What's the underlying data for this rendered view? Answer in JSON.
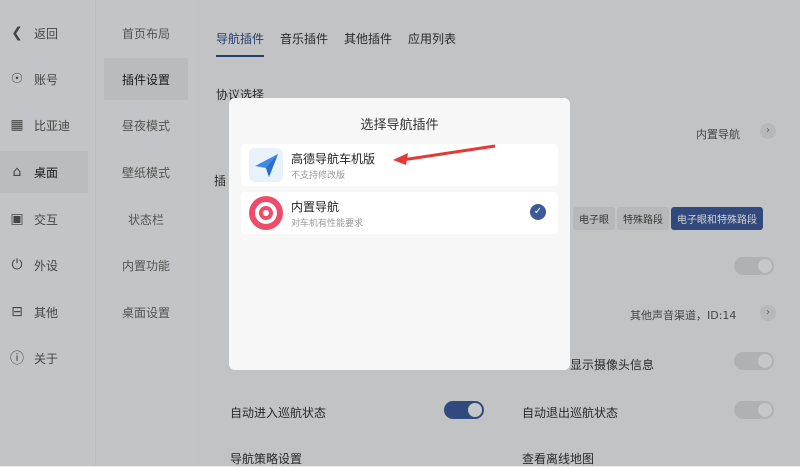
{
  "sidebar": {
    "items": [
      {
        "icon": "back-icon",
        "label": "返回"
      },
      {
        "icon": "account-icon",
        "label": "账号"
      },
      {
        "icon": "byd-icon",
        "label": "比亚迪"
      },
      {
        "icon": "home-icon",
        "label": "桌面"
      },
      {
        "icon": "interaction-icon",
        "label": "交互"
      },
      {
        "icon": "power-icon",
        "label": "外设"
      },
      {
        "icon": "other-icon",
        "label": "其他"
      },
      {
        "icon": "info-icon",
        "label": "关于"
      }
    ]
  },
  "submenu": {
    "items": [
      "首页布局",
      "插件设置",
      "昼夜模式",
      "壁纸模式",
      "状态栏",
      "内置功能",
      "桌面设置"
    ]
  },
  "main": {
    "tabs": [
      "导航插件",
      "音乐插件",
      "其他插件",
      "应用列表"
    ],
    "protocol_title": "协议选择",
    "plugin_title_partial": "插",
    "builtin_nav_value": "内置导航",
    "segment_options": [
      "电子眼",
      "特殊路段",
      "电子眼和特殊路段"
    ],
    "audio_channel_value": "其他声音渠道，ID:14",
    "camera_info_label": "显示摄像头信息",
    "auto_enter_label": "自动进入巡航状态",
    "auto_exit_label": "自动退出巡航状态",
    "bottom_left_partial": "导航策略设置",
    "bottom_right_partial": "查看离线地图"
  },
  "modal": {
    "title": "选择导航插件",
    "options": [
      {
        "name": "高德导航车机版",
        "sub": "不支持修改版",
        "selected": false
      },
      {
        "name": "内置导航",
        "sub": "对车机有性能要求",
        "selected": true
      }
    ]
  },
  "colors": {
    "accent": "#3d5a99",
    "arrow": "#e53935"
  }
}
